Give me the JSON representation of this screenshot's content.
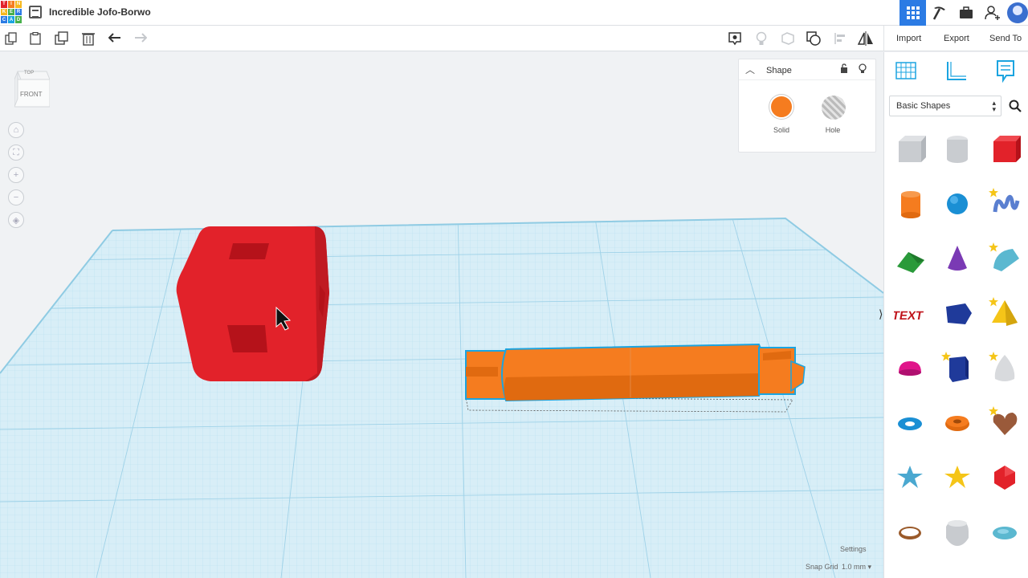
{
  "app": {
    "logo_letters": [
      "T",
      "I",
      "N",
      "K",
      "E",
      "R",
      "C",
      "A",
      "D"
    ],
    "title": "Incredible Jofo-Borwo"
  },
  "toolbar": {
    "import": "Import",
    "export": "Export",
    "send_to": "Send To"
  },
  "viewcube": {
    "top": "TOP",
    "front": "FRONT"
  },
  "shape_panel": {
    "title": "Shape",
    "solid_label": "Solid",
    "hole_label": "Hole",
    "solid_color": "#f57c1f"
  },
  "library": {
    "category": "Basic Shapes",
    "shapes": [
      "box-hole",
      "cylinder-hole",
      "box",
      "cylinder",
      "sphere",
      "scribble",
      "roof",
      "cone",
      "round-roof",
      "text",
      "polygon",
      "pyramid",
      "half-sphere",
      "hexagonal-prism",
      "paraboloid",
      "torus",
      "tube",
      "heart",
      "star",
      "star-6",
      "icosahedron",
      "ring",
      "extruded-heart",
      "ellipsoid"
    ]
  },
  "footer": {
    "settings": "Settings",
    "snap_grid_label": "Snap Grid",
    "snap_grid_value": "1.0 mm"
  },
  "colors": {
    "accent": "#2b7be4",
    "grid": "#c8e6f2",
    "red_box": "#e2222a",
    "orange_shape": "#f57c1f",
    "selection": "#1ba4e0"
  }
}
